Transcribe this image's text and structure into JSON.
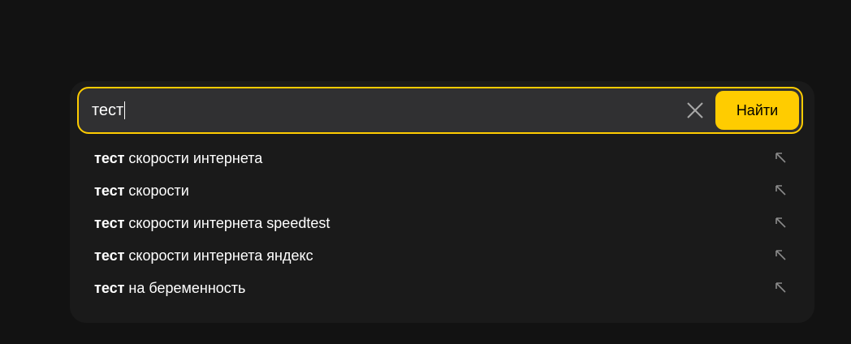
{
  "search": {
    "query": "тест",
    "button_label": "Найти",
    "clear_icon": "close-icon"
  },
  "colors": {
    "accent": "#ffcc00",
    "background": "#121212",
    "panel": "#1a1a1a",
    "input_bg": "#303032",
    "text": "#ffffff",
    "icon": "#8a8a8a"
  },
  "suggestions": [
    {
      "bold": "тест",
      "rest": " скорости интернета",
      "icon": "fill-arrow-icon"
    },
    {
      "bold": "тест",
      "rest": " скорости",
      "icon": "fill-arrow-icon"
    },
    {
      "bold": "тест",
      "rest": " скорости интернета speedtest",
      "icon": "fill-arrow-icon"
    },
    {
      "bold": "тест",
      "rest": " скорости интернета яндекс",
      "icon": "fill-arrow-icon"
    },
    {
      "bold": "тест",
      "rest": " на беременность",
      "icon": "fill-arrow-icon"
    }
  ]
}
